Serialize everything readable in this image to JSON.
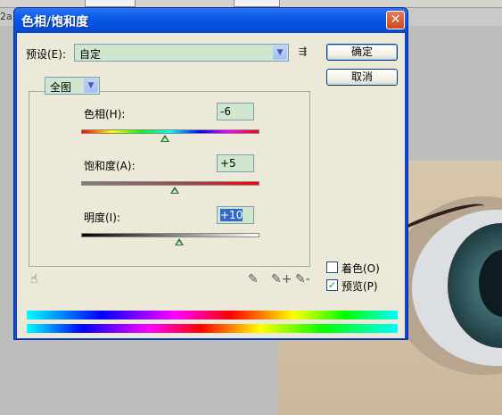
{
  "background": {
    "tab_label": "2a",
    "accent_color": "#0a5ae9"
  },
  "dialog": {
    "title": "色相/饱和度",
    "close_icon": "✕"
  },
  "preset": {
    "label": "预设(E):",
    "value": "自定",
    "menu_icon": "⇶"
  },
  "buttons": {
    "ok": "确定",
    "cancel": "取消"
  },
  "channel": {
    "value": "全图"
  },
  "hue": {
    "label": "色相(H):",
    "value": "-6",
    "slider_fraction": 0.47
  },
  "saturation": {
    "label": "饱和度(A):",
    "value": "+5",
    "slider_fraction": 0.525
  },
  "lightness": {
    "label": "明度(I):",
    "value": "+10",
    "slider_fraction": 0.55
  },
  "tools": {
    "hand_icon": "☝",
    "eyedropper_icon": "✎",
    "eyedropper_plus_icon": "✎+",
    "eyedropper_minus_icon": "✎-"
  },
  "options": {
    "colorize_label": "着色(O)",
    "colorize_checked": false,
    "preview_label": "预览(P)",
    "preview_checked": true,
    "check_mark": "✓"
  }
}
